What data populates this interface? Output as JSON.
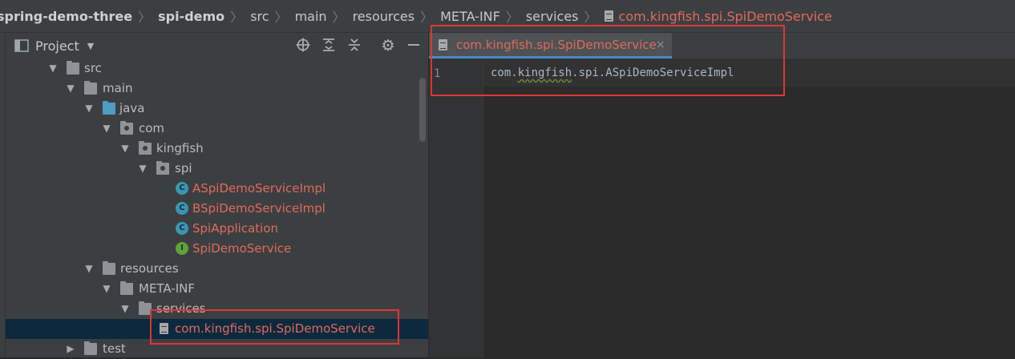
{
  "breadcrumb": {
    "items": [
      "spring-demo-three",
      "spi-demo",
      "src",
      "main",
      "resources",
      "META-INF",
      "services"
    ],
    "file": "com.kingfish.spi.SpiDemoService"
  },
  "project_panel": {
    "title": "Project",
    "dropdown_icon": "chevron-down-icon",
    "toolbar_icons": [
      "locate-icon",
      "expand-all-icon",
      "collapse-all-icon",
      "gear-icon",
      "minimize-icon"
    ]
  },
  "tree": [
    {
      "label": "src",
      "arrow": "▼"
    },
    {
      "label": "main",
      "arrow": "▼"
    },
    {
      "label": "java",
      "arrow": "▼"
    },
    {
      "label": "com",
      "arrow": "▼"
    },
    {
      "label": "kingfish",
      "arrow": "▼"
    },
    {
      "label": "spi",
      "arrow": "▼"
    },
    {
      "label": "ASpiDemoServiceImpl",
      "kind": "class",
      "badge": "C"
    },
    {
      "label": "BSpiDemoServiceImpl",
      "kind": "class",
      "badge": "C"
    },
    {
      "label": "SpiApplication",
      "kind": "class",
      "badge": "C"
    },
    {
      "label": "SpiDemoService",
      "kind": "interface",
      "badge": "I"
    },
    {
      "label": "resources",
      "arrow": "▼"
    },
    {
      "label": "META-INF",
      "arrow": "▼"
    },
    {
      "label": "services",
      "arrow": "▼"
    },
    {
      "label": "com.kingfish.spi.SpiDemoService",
      "kind": "file",
      "selected": true
    },
    {
      "label": "test",
      "arrow": "▶"
    }
  ],
  "editor": {
    "tab_label": "com.kingfish.spi.SpiDemoService",
    "tab_close": "×",
    "line_number": "1",
    "code_prefix": "com.",
    "code_word": "kingfish",
    "code_suffix": ".spi.ASpiDemoServiceImpl"
  },
  "colors": {
    "accent": "#4a88c7",
    "modified_file": "#e06a5a",
    "highlight_box": "#e03535"
  }
}
